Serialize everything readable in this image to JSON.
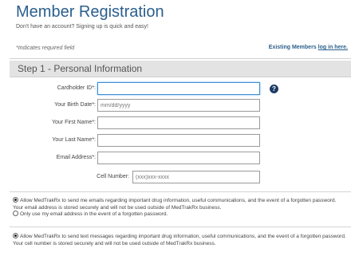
{
  "header": {
    "title": "Member Registration",
    "subtitle": "Don't have an account? Signing up is quick and easy!",
    "required_note": "*Indicates required field",
    "existing_prefix": "Existing Members",
    "existing_link": "log in here."
  },
  "step": {
    "title": "Step 1 - Personal Information"
  },
  "fields": {
    "cardholder": {
      "label": "Cardholder ID*:",
      "value": "",
      "placeholder": ""
    },
    "birth_date": {
      "label": "Your Birth Date*:",
      "value": "",
      "placeholder": "mm/dd/yyyy"
    },
    "first_name": {
      "label": "Your First Name*:",
      "value": "",
      "placeholder": ""
    },
    "last_name": {
      "label": "Your Last Name*:",
      "value": "",
      "placeholder": ""
    },
    "email": {
      "label": "Email Address*:",
      "value": "",
      "placeholder": ""
    },
    "cell": {
      "label": "Cell Number:",
      "value": "",
      "placeholder": "(xxx)xxx-xxxx"
    }
  },
  "help_icon": {
    "glyph": "?",
    "icon": "question-circle-icon"
  },
  "email_options": {
    "allow": "Allow MedTrakRx to send me emails regarding important drug information, useful communications, and the event of a forgotten password. Your email address is stored securely and will not be used outside of MedTrakRx business.",
    "only": "Only use my email address in the event of a forgotten password.",
    "selected": "allow"
  },
  "sms_options": {
    "allow": "Allow MedTrakRx to send text messages regarding important drug information, useful communications, and the event of a forgotten password. Your cell number is stored securely and will not be used outside of MedTrakRx business.",
    "selected": "allow"
  },
  "colors": {
    "title": "#2b5f8c",
    "header_bg": "#e3e3e3",
    "focus_border": "#3b8fd6",
    "help_icon": "#1f3c66"
  }
}
